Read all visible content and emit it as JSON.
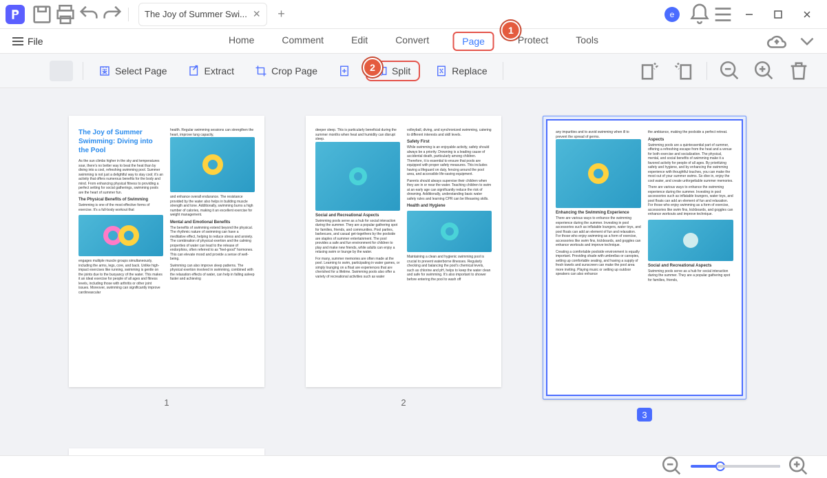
{
  "titlebar": {
    "tab_title": "The Joy of Summer Swi...",
    "avatar_letter": "e"
  },
  "menubar": {
    "file_label": "File",
    "items": [
      "Home",
      "Comment",
      "Edit",
      "Convert",
      "Page",
      "Protect",
      "Tools"
    ],
    "active_index": 4,
    "callout1": "1"
  },
  "toolbar": {
    "select_page": "Select Page",
    "extract": "Extract",
    "crop_page": "Crop Page",
    "split": "Split",
    "replace": "Replace",
    "callout2": "2"
  },
  "pages": {
    "p1": {
      "title": "The Joy of Summer Swimming: Diving into the Pool",
      "intro": "As the sun climbs higher in the sky and temperatures soar, there's no better way to beat the heat than by diving into a cool, refreshing swimming pool. Summer swimming is not just a delightful way to stay cool; it's an activity that offers numerous benefits for the body and mind. From enhancing physical fitness to providing a perfect setting for social gatherings, swimming pools are the heart of summer fun.",
      "h1": "The Physical Benefits of Swimming",
      "t1": "Swimming is one of the most effective forms of exercise. It's a full-body workout that",
      "t1b": "engages multiple muscle groups simultaneously, including the arms, legs, core, and back. Unlike high-impact exercises like running, swimming is gentle on the joints due to the buoyancy of the water. This makes it an ideal exercise for people of all ages and fitness levels, including those with arthritis or other joint issues. Moreover, swimming can significantly improve cardiovascular",
      "r1": "health. Regular swimming sessions can strengthen the heart, improve lung capacity,",
      "r2": "and enhance overall endurance. The resistance provided by the water also helps in building muscle strength and tone. Additionally, swimming burns a high number of calories, making it an excellent exercise for weight management.",
      "h2": "Mental and Emotional Benefits",
      "r3": "The benefits of swimming extend beyond the physical. The rhythmic nature of swimming can have a meditative effect, helping to reduce stress and anxiety. The combination of physical exertion and the calming properties of water can lead to the release of endorphins, often referred to as \"feel-good\" hormones. This can elevate mood and provide a sense of well-being.",
      "r4": "Swimming can also improve sleep patterns. The physical exertion involved in swimming, combined with the relaxation effects of water, can help in falling asleep faster and achieving"
    },
    "p2": {
      "l1": "deeper sleep. This is particularly beneficial during the summer months when heat and humidity can disrupt sleep.",
      "h1": "Social and Recreational Aspects",
      "l2": "Swimming pools serve as a hub for social interaction during the summer. They are a popular gathering spot for families, friends, and communities. Pool parties, barbecues, and casual get-togethers by the poolside are staples of summer entertainment. The pool provides a safe and fun environment for children to play and make new friends, while adults can enjoy a relaxing swim or lounge by the water.",
      "l3": "For many, summer memories are often made at the pool. Learning to swim, participating in water games, or simply lounging on a float are experiences that are cherished for a lifetime. Swimming pools also offer a variety of recreational activities such as water",
      "r1": "volleyball, diving, and synchronized swimming, catering to different interests and skill levels.",
      "h2": "Safety First",
      "r2": "While swimming is an enjoyable activity, safety should always be a priority. Drowning is a leading cause of accidental death, particularly among children. Therefore, it is essential to ensure that pools are equipped with proper safety measures. This includes having a lifeguard on duty, fencing around the pool area, and accessible life-saving equipment.",
      "r3": "Parents should always supervise their children when they are in or near the water. Teaching children to swim at an early age can significantly reduce the risk of drowning. Additionally, understanding basic water safety rules and learning CPR can be lifesaving skills.",
      "h3": "Health and Hygiene",
      "r4": "Maintaining a clean and hygienic swimming pool is crucial to prevent waterborne illnesses. Regularly checking and balancing the pool's chemical levels, such as chlorine and pH, helps to keep the water clean and safe for swimming. It's also important to shower before entering the pool to wash off"
    },
    "p3": {
      "l1": "any impurities and to avoid swimming when ill to prevent the spread of germs.",
      "h1": "Enhancing the Swimming Experience",
      "l2": "There are various ways to enhance the swimming experience during the summer. Investing in pool accessories such as inflatable loungers, water toys, and pool floats can add an element of fun and relaxation. For those who enjoy swimming as a form of exercise, accessories like swim fins, kickboards, and goggles can enhance workouts and improve technique.",
      "l3": "Creating a comfortable poolside environment is equally important. Providing shade with umbrellas or canopies, setting up comfortable seating, and having a supply of fresh towels and sunscreen can make the pool area more inviting. Playing music or setting up outdoor speakers can also enhance",
      "r1": "the ambiance, making the poolside a perfect retreat.",
      "h2": "Aspects",
      "r2": "Swimming pools are a quintessential part of summer, offering a refreshing escape from the heat and a venue for both exercise and socialization. The physical, mental, and social benefits of swimming make it a favored activity for people of all ages. By prioritizing safety and hygiene, and by enhancing the swimming experience with thoughtful touches, you can make the most out of your summer swims. So dive in, enjoy the cool water, and create unforgettable summer memories.",
      "r3": "There are various ways to enhance the swimming experience during the summer. Investing in pool accessories such as inflatable loungers, water toys, and pool floats can add an element of fun and relaxation. For those who enjoy swimming as a form of exercise, accessories like swim fins, kickboards, and goggles can enhance workouts and improve technique.",
      "h3": "Social and Recreational Aspects",
      "r4": "Swimming pools serve as a hub for social interaction during the summer. They are a popular gathering spot for families, friends,"
    },
    "labels": [
      "1",
      "2",
      "3"
    ]
  }
}
